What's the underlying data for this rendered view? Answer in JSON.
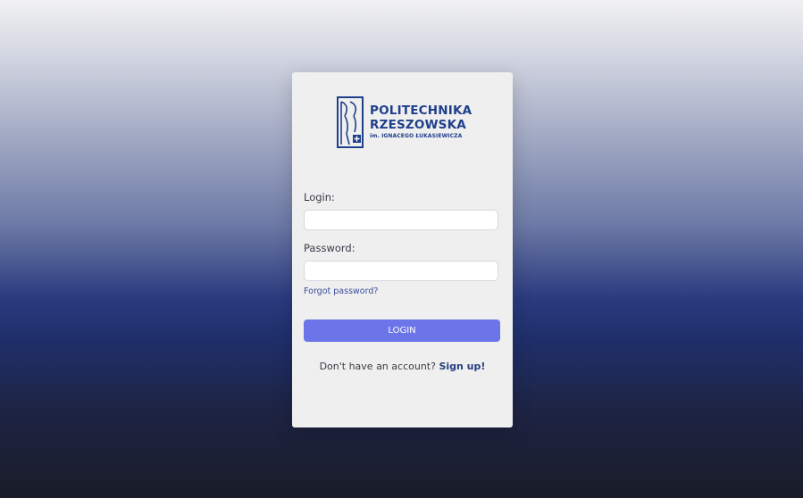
{
  "logo": {
    "line1": "POLITECHNIKA",
    "line2": "RZESZOWSKA",
    "line3": "im. IGNACEGO ŁUKASIEWICZA"
  },
  "form": {
    "login_label": "Login:",
    "login_value": "",
    "password_label": "Password:",
    "password_value": "",
    "forgot_label": "Forgot password?",
    "submit_label": "LOGIN"
  },
  "signup": {
    "prompt": "Don't have an account?",
    "link_label": "Sign up!"
  },
  "colors": {
    "brand": "#1f3f8a",
    "button": "#6b74e8",
    "card": "#efeff0"
  }
}
